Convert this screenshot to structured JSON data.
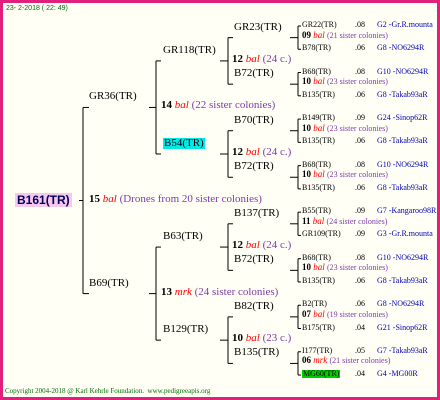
{
  "header": {
    "timestamp": "23- 2-2018 ( 22: 49)"
  },
  "footer": {
    "copyright": "Copyright 2004-2018 @ Karl Kehrle Foundation.",
    "website": "www.pedigreeapis.org"
  },
  "root": {
    "id": "B161(TR)",
    "gen_num": "15",
    "breed": "bal",
    "note": "(Drones from 20 sister colonies)"
  },
  "gen1": [
    {
      "id": "GR36(TR)",
      "gen_num": "14",
      "breed": "bal",
      "note": "(22 sister colonies)"
    },
    {
      "id": "B69(TR)",
      "gen_num": "13",
      "breed": "mrk",
      "note": "(24 sister colonies)"
    }
  ],
  "gen2": [
    {
      "id": "GR118(TR)",
      "gen_num": "12",
      "breed": "bal",
      "note": "(24 c.)"
    },
    {
      "id": "B54(TR)",
      "gen_num": "12",
      "breed": "bal",
      "note": "(24 c.)"
    },
    {
      "id": "B63(TR)",
      "gen_num": "12",
      "breed": "bal",
      "note": "(24 c.)"
    },
    {
      "id": "B129(TR)",
      "gen_num": "10",
      "breed": "bal",
      "note": "(23 c.)"
    }
  ],
  "gen3": [
    {
      "id": "GR23(TR)",
      "gen_num": "09",
      "breed": "bal",
      "note": "(21 sister colonies)"
    },
    {
      "id": "B72(TR)",
      "gen_num": "10",
      "breed": "bal",
      "note": "(23 sister colonies)"
    },
    {
      "id": "B70(TR)",
      "gen_num": "10",
      "breed": "bal",
      "note": "(23 sister colonies)"
    },
    {
      "id": "B72(TR)",
      "gen_num": "10",
      "breed": "bal",
      "note": "(23 sister colonies)"
    },
    {
      "id": "B137(TR)",
      "gen_num": "11",
      "breed": "bal",
      "note": "(24 sister colonies)"
    },
    {
      "id": "B72(TR)",
      "gen_num": "10",
      "breed": "bal",
      "note": "(23 sister colonies)"
    },
    {
      "id": "B82(TR)",
      "gen_num": "07",
      "breed": "bal",
      "note": "(19 sister colonies)"
    },
    {
      "id": "B135(TR)",
      "gen_num": "06",
      "breed": "mrk",
      "note": "(21 sister colonies)"
    }
  ],
  "gen4": [
    {
      "id": "GR22(TR)",
      "year": ".08",
      "source": "G2 -Gr.R.mounta"
    },
    {
      "id": "B78(TR)",
      "year": ".06",
      "source": "G8 -NO6294R"
    },
    {
      "id": "B68(TR)",
      "year": ".08",
      "source": "G10 -NO6294R"
    },
    {
      "id": "B135(TR)",
      "year": ".06",
      "source": "G8 -Takab93aR"
    },
    {
      "id": "B149(TR)",
      "year": ".09",
      "source": "G24 -Sinop62R"
    },
    {
      "id": "B135(TR)",
      "year": ".06",
      "source": "G8 -Takab93aR"
    },
    {
      "id": "B68(TR)",
      "year": ".08",
      "source": "G10 -NO6294R"
    },
    {
      "id": "B135(TR)",
      "year": ".06",
      "source": "G8 -Takab93aR"
    },
    {
      "id": "B55(TR)",
      "year": ".09",
      "source": "G7 -Kangaroo98R"
    },
    {
      "id": "GR109(TR)",
      "year": ".09",
      "source": "G3 -Gr.R.mounta"
    },
    {
      "id": "B68(TR)",
      "year": ".08",
      "source": "G10 -NO6294R"
    },
    {
      "id": "B135(TR)",
      "year": ".06",
      "source": "G8 -Takab93aR"
    },
    {
      "id": "B2(TR)",
      "year": ".06",
      "source": "G8 -NO6294R"
    },
    {
      "id": "B175(TR)",
      "year": ".04",
      "source": "G21 -Sinop62R"
    },
    {
      "id": "I177(TR)",
      "year": ".05",
      "source": "G7 -Takab93aR"
    },
    {
      "id": "MG60(TR)",
      "year": ".04",
      "source": "G4 -MG00R"
    }
  ]
}
